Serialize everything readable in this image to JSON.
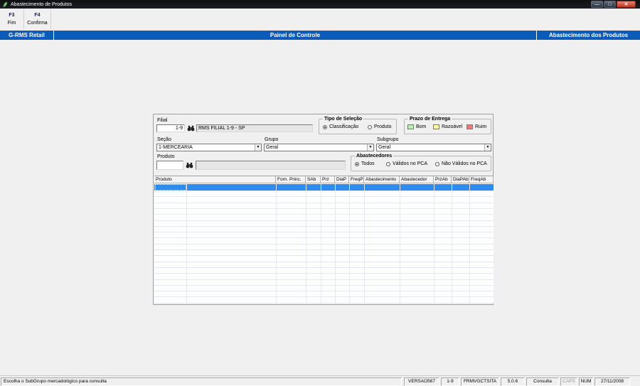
{
  "window": {
    "title": "Abastecimento de Produtos",
    "icon": "app-leaf-icon",
    "controls": [
      "minimize",
      "maximize",
      "close"
    ]
  },
  "toolbar": {
    "f3": {
      "key": "F3",
      "label": "Fim"
    },
    "f4": {
      "key": "F4",
      "label": "Confirma"
    }
  },
  "header": {
    "left": "G-RMS Retail",
    "center": "Painel de Controle",
    "right": "Abastecimento dos Produtos"
  },
  "form": {
    "filial": {
      "label": "Filial",
      "code": "1-9",
      "description": "RMS FILIAL 1-9 - SP"
    },
    "tipo_selecao": {
      "title": "Tipo de Seleção",
      "options": [
        {
          "label": "Classificação",
          "selected": true
        },
        {
          "label": "Produto",
          "selected": false
        }
      ]
    },
    "prazo_entrega": {
      "title": "Prazo de Entrega",
      "items": [
        {
          "label": "Bom",
          "color": "#b8f0b0"
        },
        {
          "label": "Razoável",
          "color": "#ffffa8"
        },
        {
          "label": "Ruim",
          "color": "#f07a7a"
        }
      ]
    },
    "secao": {
      "label": "Seção",
      "value": "1-MERCEARIA"
    },
    "grupo": {
      "label": "Grupo",
      "value": "Geral"
    },
    "subgrupo": {
      "label": "Subgrupo",
      "value": "Geral"
    },
    "produto": {
      "label": "Produto",
      "code": "",
      "description": ""
    },
    "abastecedores": {
      "title": "Abastecedores",
      "options": [
        {
          "label": "Todos",
          "selected": true
        },
        {
          "label": "Válidos no PCA",
          "selected": false
        },
        {
          "label": "Não Válidos no PCA",
          "selected": false
        }
      ]
    }
  },
  "grid": {
    "columns": [
      "Produto",
      "Forn. Princ.",
      "SAb",
      "Prz",
      "DiaP",
      "FreqP",
      "Abastecimento",
      "Abastecedor",
      "PrzAb",
      "DiaPAb",
      "FreqAb"
    ],
    "selected_row": 1,
    "rows": []
  },
  "statusbar": {
    "message": "Escolha o SubGrupo mercadológico para consulta",
    "version": "VERSAO567",
    "filial": "1-9",
    "form": "FRMVGCTSITA",
    "release": "5.0.6",
    "mode": "Consulta",
    "caps": "CAPS",
    "num": "NUM",
    "date": "27/11/2008"
  },
  "colors": {
    "header_blue": "#0a5cb8",
    "selection_blue": "#2e8bef"
  }
}
